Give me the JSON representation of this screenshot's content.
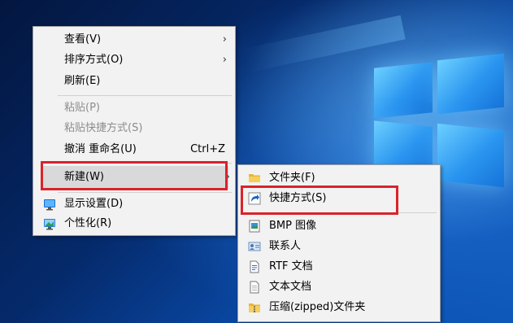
{
  "context_menu": {
    "items": [
      {
        "label": "查看(V)",
        "has_submenu": true,
        "disabled": false
      },
      {
        "label": "排序方式(O)",
        "has_submenu": true,
        "disabled": false
      },
      {
        "label": "刷新(E)",
        "has_submenu": false,
        "disabled": false
      },
      {
        "label": "粘贴(P)",
        "has_submenu": false,
        "disabled": true
      },
      {
        "label": "粘贴快捷方式(S)",
        "has_submenu": false,
        "disabled": true
      },
      {
        "label": "撤消 重命名(U)",
        "shortcut": "Ctrl+Z",
        "has_submenu": false,
        "disabled": false
      },
      {
        "label": "新建(W)",
        "has_submenu": true,
        "disabled": false,
        "selected": true
      },
      {
        "label": "显示设置(D)",
        "icon": "display-settings-icon",
        "has_submenu": false,
        "disabled": false
      },
      {
        "label": "个性化(R)",
        "icon": "personalize-icon",
        "has_submenu": false,
        "disabled": false
      }
    ],
    "submenu_arrow": "›"
  },
  "new_submenu": {
    "items": [
      {
        "label": "文件夹(F)",
        "icon": "folder-icon"
      },
      {
        "label": "快捷方式(S)",
        "icon": "shortcut-icon"
      },
      {
        "label": "BMP 图像",
        "icon": "bmp-image-icon"
      },
      {
        "label": "联系人",
        "icon": "contact-icon"
      },
      {
        "label": "RTF 文档",
        "icon": "rtf-document-icon"
      },
      {
        "label": "文本文档",
        "icon": "text-document-icon"
      },
      {
        "label": "压缩(zipped)文件夹",
        "icon": "zip-folder-icon"
      }
    ]
  },
  "colors": {
    "highlight_box": "#d9232a",
    "menu_bg": "#f2f2f2",
    "selected_bg": "#d9d9d9",
    "disabled_text": "#8c8c8c"
  }
}
